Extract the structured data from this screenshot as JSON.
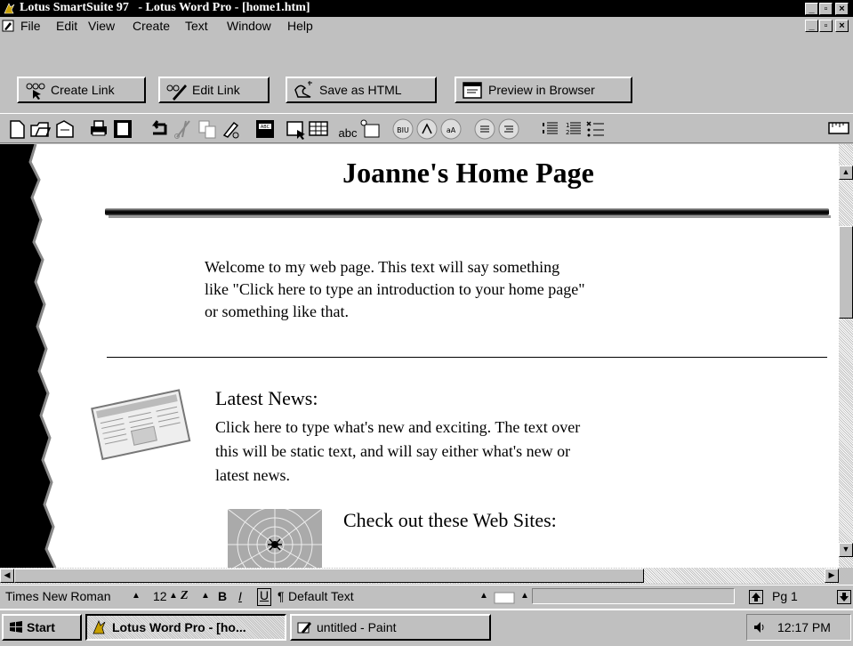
{
  "window": {
    "title": "Lotus SmartSuite 97   - Lotus Word Pro - [home1.htm]"
  },
  "menu": {
    "items": [
      "File",
      "Edit",
      "View",
      "Create",
      "Text",
      "Window",
      "Help"
    ]
  },
  "linkbar": {
    "create_link": "Create Link",
    "edit_link": "Edit Link",
    "save_html": "Save as HTML",
    "preview": "Preview in Browser"
  },
  "iconbar": {
    "abc_label": "abc"
  },
  "document": {
    "heading": "Joanne's Home Page",
    "intro_lines": [
      "Welcome to my web page. This text will say something",
      "like \"Click here to type an introduction to your home page\"",
      "or something like that."
    ],
    "news_title": "Latest News:",
    "news_lines": [
      "Click here to type what's new and exciting. The text over",
      "this will be static text, and will say either what's new or",
      "latest news."
    ],
    "web_title": "Check out these Web Sites:"
  },
  "statusbar": {
    "font": "Times New Roman",
    "size": "12",
    "style": "Default Text",
    "page": "Pg 1"
  },
  "taskbar": {
    "start": "Start",
    "task1": "Lotus Word Pro - [ho...",
    "task2": "untitled - Paint",
    "time": "12:17 PM"
  }
}
